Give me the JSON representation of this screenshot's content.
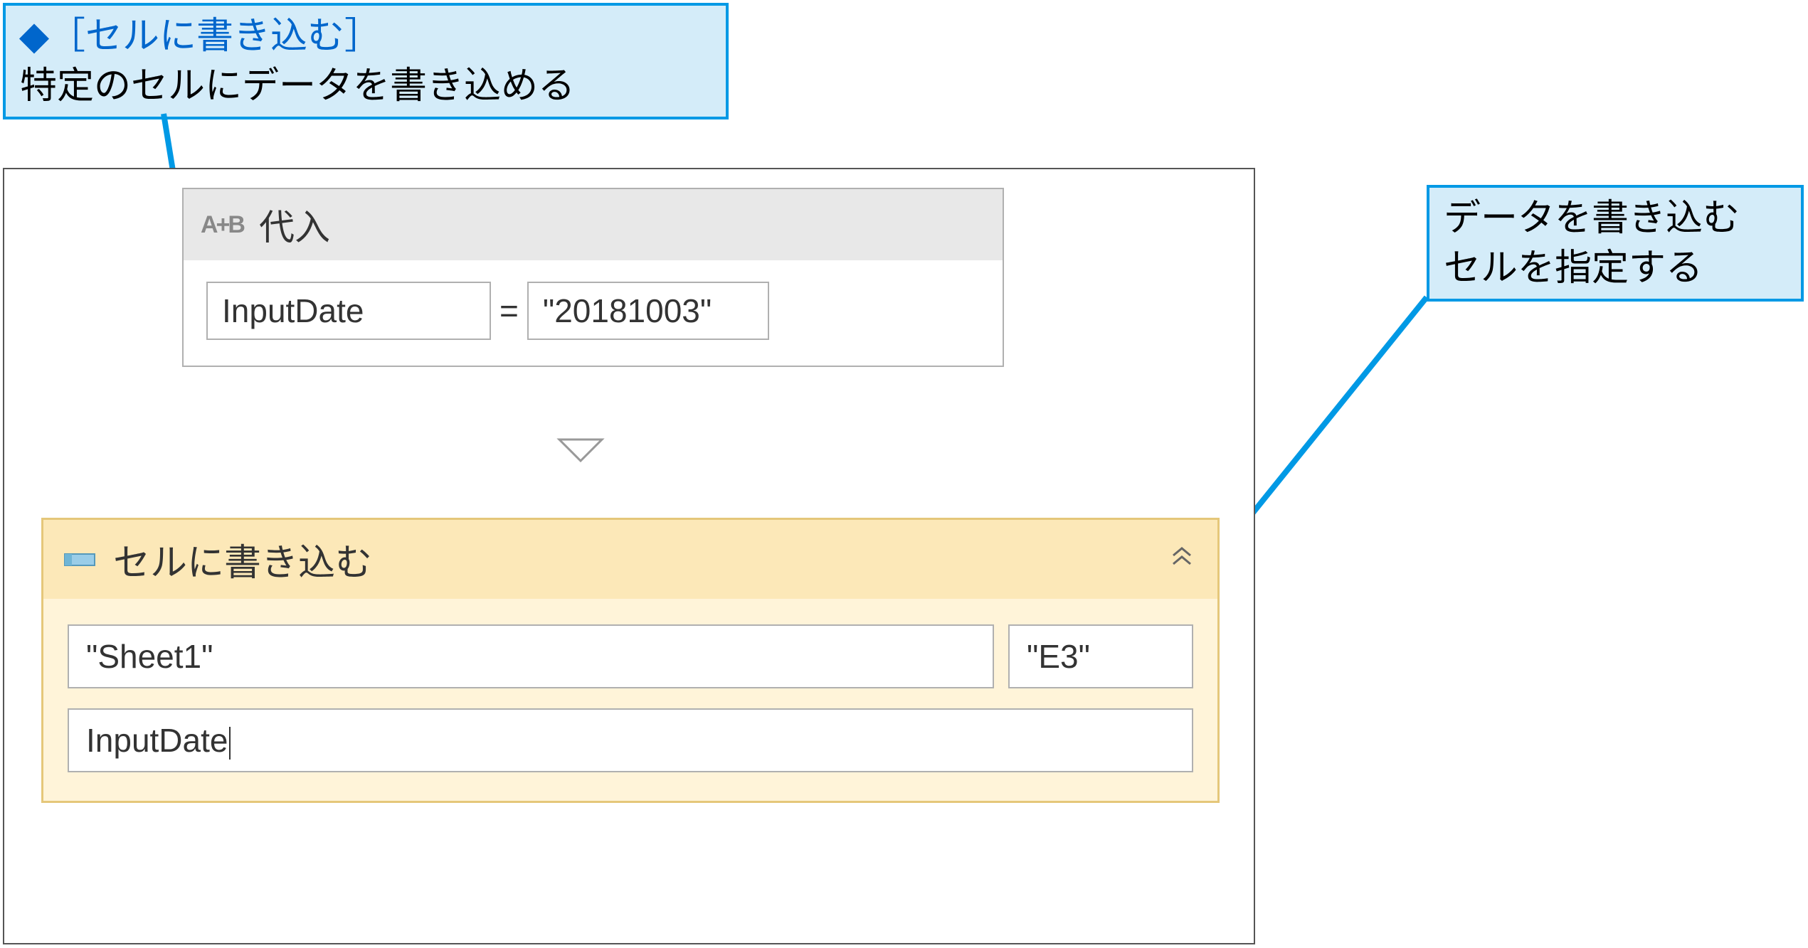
{
  "callout_top": {
    "diamond": "◆",
    "bracket_open": "［",
    "title": "セルに書き込む",
    "bracket_close": "］",
    "description": "特定のセルにデータを書き込める"
  },
  "callout_right": {
    "line1": "データを書き込む",
    "line2": "セルを指定する"
  },
  "assign": {
    "icon": "A+B",
    "title": "代入",
    "left_value": "InputDate",
    "equals": "=",
    "right_value": "\"20181003\""
  },
  "flow_arrow": "▽",
  "write": {
    "title": "セルに書き込む",
    "collapse": "︽",
    "sheet_value": "\"Sheet1\"",
    "cell_value": "\"E3\"",
    "data_value": "InputDate"
  }
}
